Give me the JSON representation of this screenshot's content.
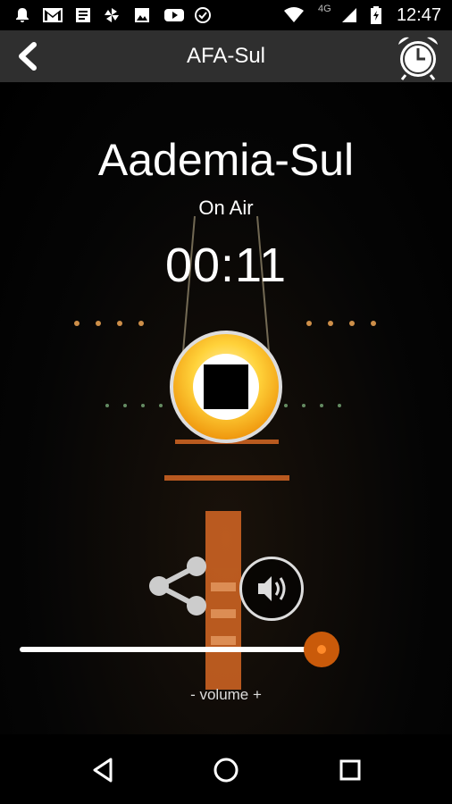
{
  "status_bar": {
    "time": "12:47",
    "network": "4G",
    "icons": [
      "bell-icon",
      "gmail-icon",
      "news-icon",
      "pinwheel-icon",
      "photos-icon",
      "youtube-icon",
      "check-circle-icon",
      "wifi-icon",
      "signal-icon",
      "battery-icon"
    ]
  },
  "toolbar": {
    "title": "AFA-Sul"
  },
  "player": {
    "station_name": "Aademia-Sul",
    "status": "On Air",
    "elapsed": "00:11",
    "volume_label": "- volume +",
    "volume_level": 0.95
  },
  "colors": {
    "accent": "#f09a10",
    "thumb": "#c95a0a",
    "toolbar": "#2f2f2f"
  }
}
